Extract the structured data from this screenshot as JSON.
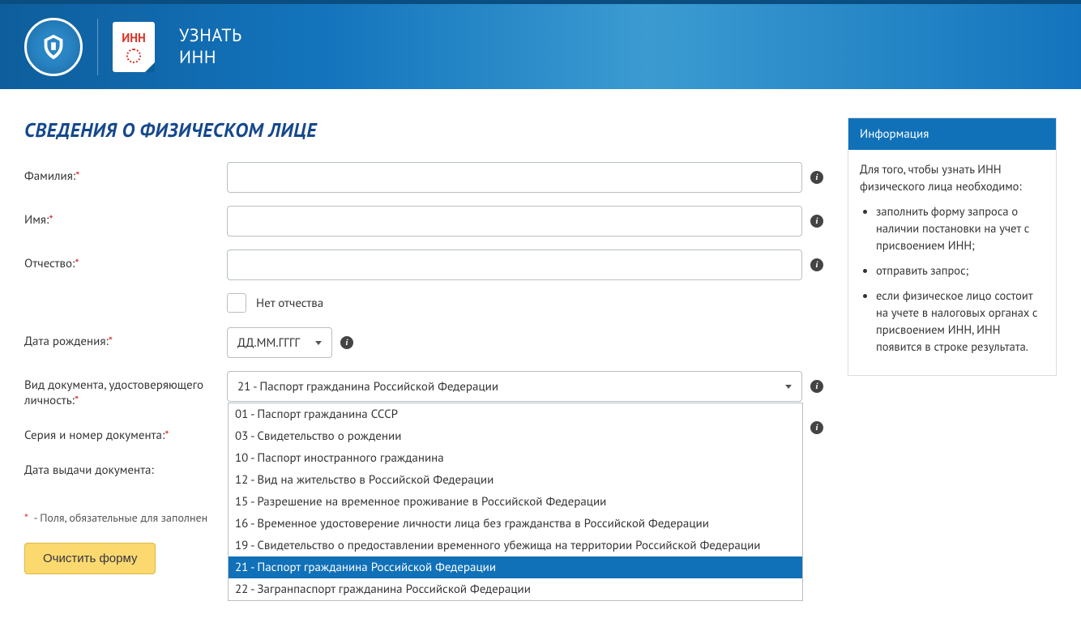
{
  "header": {
    "doc_badge": "ИНН",
    "title_line1": "УЗНАТЬ",
    "title_line2": "ИНН"
  },
  "form": {
    "section_title": "СВЕДЕНИЯ О ФИЗИЧЕСКОМ ЛИЦЕ",
    "labels": {
      "lastname": "Фамилия:",
      "firstname": "Имя:",
      "patronymic": "Отчество:",
      "no_patronymic": "Нет отчества",
      "birthdate": "Дата рождения:",
      "birthdate_placeholder": "ДД.ММ.ГГГГ",
      "doc_type": "Вид документа, удостоверяющего личность:",
      "doc_series": "Серия и номер документа:",
      "doc_issue_date": "Дата выдачи документа:"
    },
    "doc_type_value": "21 - Паспорт гражданина Российской Федерации",
    "doc_type_options": [
      "01 - Паспорт гражданина СССР",
      "03 - Свидетельство о рождении",
      "10 - Паспорт иностранного гражданина",
      "12 - Вид на жительство в Российской Федерации",
      "15 - Разрешение на временное проживание в Российской Федерации",
      "16 - Временное удостоверение личности лица без гражданства в Российской Федерации",
      "19 - Свидетельство о предоставлении временного убежища на территории Российской Федерации",
      "21 - Паспорт гражданина Российской Федерации",
      "22 - Загранпаспорт гражданина Российской Федерации"
    ],
    "doc_type_selected_index": 7,
    "required_note": " - Поля, обязательные для заполнен",
    "clear_btn": "Очистить форму"
  },
  "sidebar": {
    "title": "Информация",
    "intro": "Для того, чтобы узнать ИНН физического лица необходимо:",
    "items": [
      "заполнить форму запроса о наличии постановки на учет с присвоением ИНН;",
      "отправить запрос;",
      "если физическое лицо состоит на учете в налоговых органах с присвоением ИНН, ИНН появится в строке результата."
    ]
  }
}
